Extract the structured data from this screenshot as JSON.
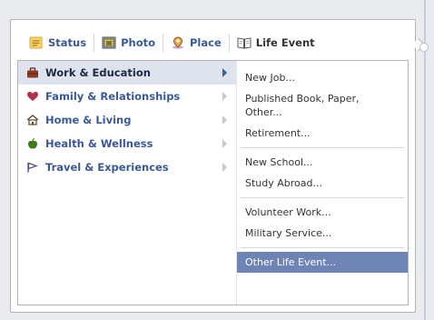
{
  "tabs": [
    {
      "label": "Status",
      "icon": "status-icon"
    },
    {
      "label": "Photo",
      "icon": "photo-icon"
    },
    {
      "label": "Place",
      "icon": "place-icon"
    },
    {
      "label": "Life Event",
      "icon": "life-event-icon",
      "active": true
    }
  ],
  "categories": [
    {
      "label": "Work & Education",
      "icon": "briefcase-icon",
      "selected": true
    },
    {
      "label": "Family & Relationships",
      "icon": "heart-icon"
    },
    {
      "label": "Home & Living",
      "icon": "house-icon"
    },
    {
      "label": "Health & Wellness",
      "icon": "apple-icon"
    },
    {
      "label": "Travel & Experiences",
      "icon": "flag-icon"
    }
  ],
  "submenu": {
    "new_job": "New Job...",
    "published": "Published Book, Paper, Other...",
    "retirement": "Retirement...",
    "new_school": "New School...",
    "study_abroad": "Study Abroad...",
    "volunteer": "Volunteer Work...",
    "military": "Military Service...",
    "other": "Other Life Event..."
  },
  "colors": {
    "link": "#3b5998",
    "selected_category_bg": "#dfe3ee",
    "selected_item_bg": "#6d84b4"
  }
}
